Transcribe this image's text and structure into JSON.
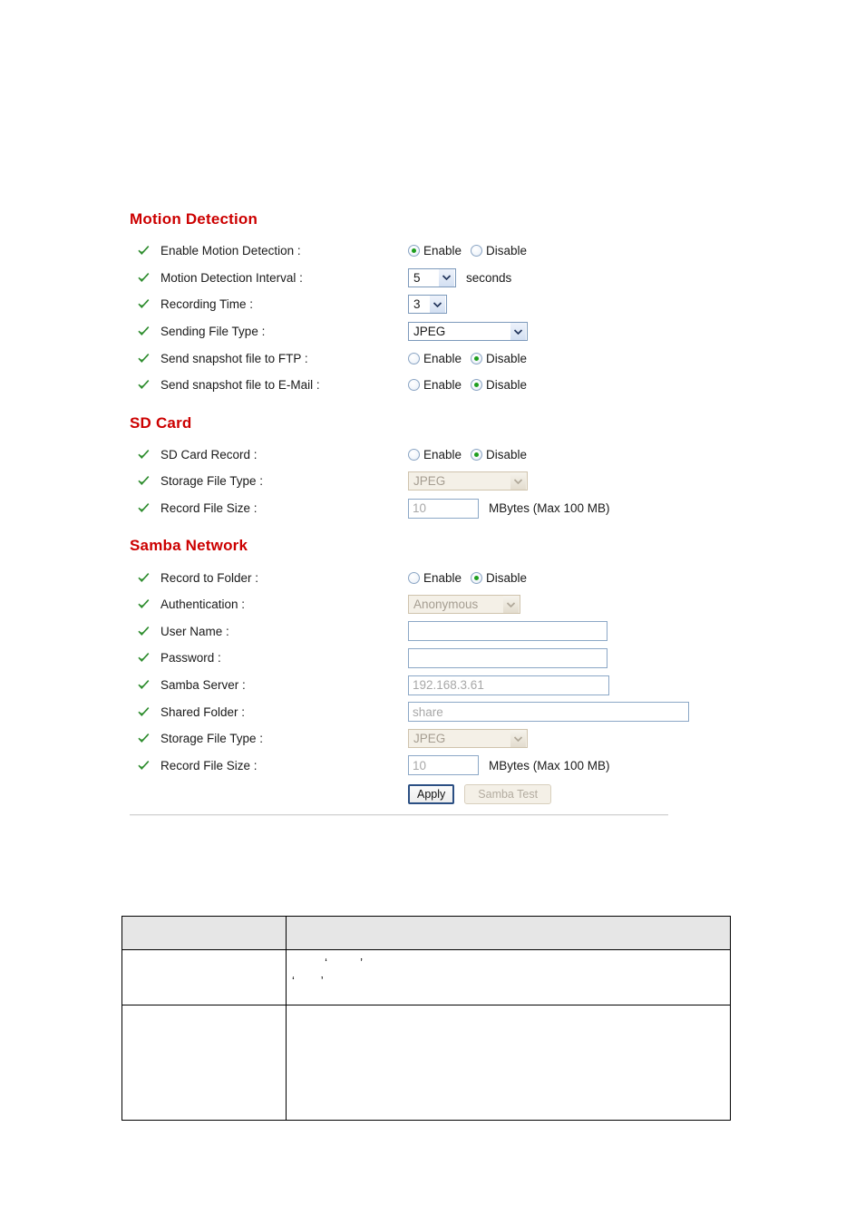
{
  "sections": [
    {
      "id": "motion-detection",
      "heading": "Motion Detection",
      "rows": [
        {
          "label": "Enable Motion Detection :",
          "control": "radio",
          "options": [
            "Enable",
            "Disable"
          ],
          "selected": "Enable"
        },
        {
          "label": "Motion Detection Interval :",
          "control": "select",
          "value": "5",
          "suffix": "seconds",
          "disabled": false
        },
        {
          "label": "Recording Time :",
          "control": "select",
          "value": "3",
          "disabled": false
        },
        {
          "label": "Sending File Type :",
          "control": "select",
          "value": "JPEG",
          "disabled": false
        },
        {
          "label": "Send snapshot file to FTP :",
          "control": "radio",
          "options": [
            "Enable",
            "Disable"
          ],
          "selected": "Disable"
        },
        {
          "label": "Send snapshot file to E-Mail :",
          "control": "radio",
          "options": [
            "Enable",
            "Disable"
          ],
          "selected": "Disable"
        }
      ]
    },
    {
      "id": "sd-card",
      "heading": "SD Card",
      "rows": [
        {
          "label": "SD Card Record :",
          "control": "radio",
          "options": [
            "Enable",
            "Disable"
          ],
          "selected": "Disable"
        },
        {
          "label": "Storage File Type :",
          "control": "select",
          "value": "JPEG",
          "disabled": true
        },
        {
          "label": "Record File Size :",
          "control": "text",
          "value": "10",
          "suffix": "MBytes (Max 100 MB)",
          "disabled": true
        }
      ]
    },
    {
      "id": "samba-network",
      "heading": "Samba Network",
      "rows": [
        {
          "label": "Record to Folder :",
          "control": "radio",
          "options": [
            "Enable",
            "Disable"
          ],
          "selected": "Disable"
        },
        {
          "label": "Authentication :",
          "control": "select",
          "value": "Anonymous",
          "disabled": true
        },
        {
          "label": "User Name :",
          "control": "text",
          "value": "",
          "disabled": false
        },
        {
          "label": "Password :",
          "control": "text",
          "value": "",
          "disabled": false
        },
        {
          "label": "Samba Server :",
          "control": "text",
          "value": "192.168.3.61",
          "disabled": true
        },
        {
          "label": "Shared Folder :",
          "control": "text",
          "value": "share",
          "disabled": true
        },
        {
          "label": "Storage File Type :",
          "control": "select",
          "value": "JPEG",
          "disabled": true
        },
        {
          "label": "Record File Size :",
          "control": "text",
          "value": "10",
          "suffix": "MBytes (Max 100 MB)",
          "disabled": true
        }
      ]
    }
  ],
  "buttons": {
    "apply": "Apply",
    "samba_test": "Samba Test"
  },
  "info_table": {
    "header": [
      "",
      ""
    ],
    "rows": [
      {
        "cells": [
          "",
          "          ‘          ’\n‘        ’"
        ]
      },
      {
        "cells": [
          "",
          ""
        ]
      }
    ]
  },
  "colors": {
    "heading_red": "#cc0000",
    "radio_green": "#1e9e1e",
    "check_green": "#3aa83a",
    "table_header_gray": "#e6e6e6",
    "input_border_blue": "#8ba7c6",
    "disabled_tan": "#f4f0e7"
  }
}
